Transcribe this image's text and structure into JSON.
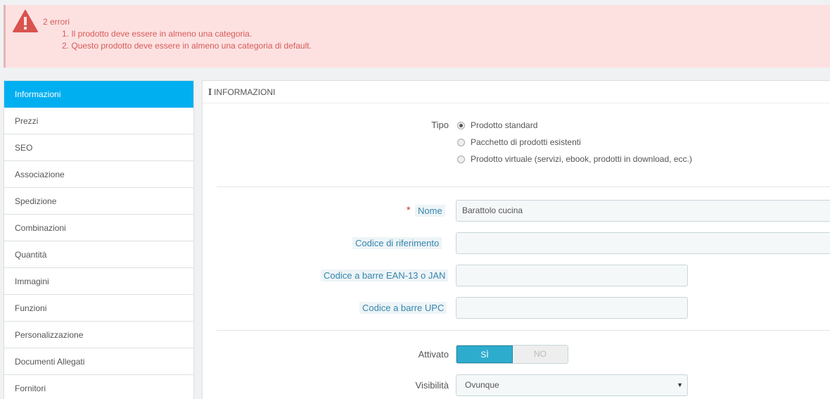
{
  "alert": {
    "title": "2 errori",
    "errors": [
      "1. Il prodotto deve essere in almeno una categoria.",
      "2. Questo prodotto deve essere in almeno una categoria di default."
    ],
    "icon": "warning-triangle-icon"
  },
  "sidebar": {
    "items": [
      {
        "label": "Informazioni",
        "active": true
      },
      {
        "label": "Prezzi"
      },
      {
        "label": "SEO"
      },
      {
        "label": "Associazione"
      },
      {
        "label": "Spedizione"
      },
      {
        "label": "Combinazioni"
      },
      {
        "label": "Quantità"
      },
      {
        "label": "Immagini"
      },
      {
        "label": "Funzioni"
      },
      {
        "label": "Personalizzazione"
      },
      {
        "label": "Documenti Allegati"
      },
      {
        "label": "Fornitori"
      }
    ]
  },
  "panel": {
    "heading": "INFORMAZIONI",
    "tipo": {
      "label": "Tipo",
      "options": [
        {
          "label": "Prodotto standard",
          "checked": true
        },
        {
          "label": "Pacchetto di prodotti esistenti"
        },
        {
          "label": "Prodotto virtuale (servizi, ebook, prodotti in download, ecc.)"
        }
      ]
    },
    "nome": {
      "required_mark": "*",
      "label": "Nome",
      "value": "Barattolo cucina"
    },
    "riferimento": {
      "label": "Codice di riferimento",
      "value": ""
    },
    "ean": {
      "label": "Codice a barre EAN-13 o JAN",
      "value": ""
    },
    "upc": {
      "label": "Codice a barre UPC",
      "value": ""
    },
    "attivato": {
      "label": "Attivato",
      "yes": "SÌ",
      "no": "NO"
    },
    "visibilita": {
      "label": "Visibilità",
      "value": "Ovunque",
      "caret": "▼"
    }
  },
  "colors": {
    "accent": "#00aff0",
    "toggle_on": "#2eacce",
    "error_bg": "#fde1e1",
    "error_text": "#d65c58"
  }
}
